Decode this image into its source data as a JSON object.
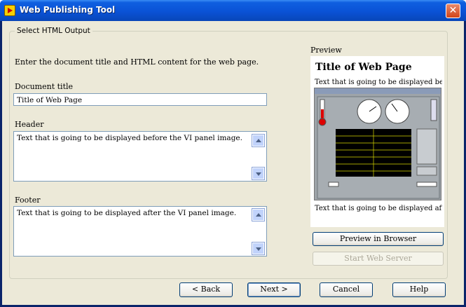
{
  "window": {
    "title": "Web Publishing Tool",
    "close_glyph": "✕"
  },
  "group": {
    "legend": "Select HTML Output"
  },
  "form": {
    "instructions": "Enter the document title and HTML content for the web page.",
    "doc_title_label": "Document title",
    "doc_title_value": "Title of Web Page",
    "header_label": "Header",
    "header_value": "Text that is going to be displayed before the VI panel image.",
    "footer_label": "Footer",
    "footer_value": "Text that is going to be displayed after the VI panel image."
  },
  "preview": {
    "label": "Preview",
    "heading": "Title of Web Page",
    "before_text": "Text that is going to be displayed bef...",
    "after_text": "Text that is going to be displayed afte...",
    "image_icon": "vi-front-panel-thumbnail"
  },
  "actions": {
    "preview_browser": "Preview in Browser",
    "start_server": "Start Web Server"
  },
  "footer_buttons": {
    "back": "< Back",
    "next": "Next >",
    "cancel": "Cancel",
    "help": "Help"
  },
  "colors": {
    "titlebar": "#0a52d6",
    "dialog_bg": "#ece9d8",
    "input_border": "#7f9db9",
    "button_border": "#003c74"
  }
}
